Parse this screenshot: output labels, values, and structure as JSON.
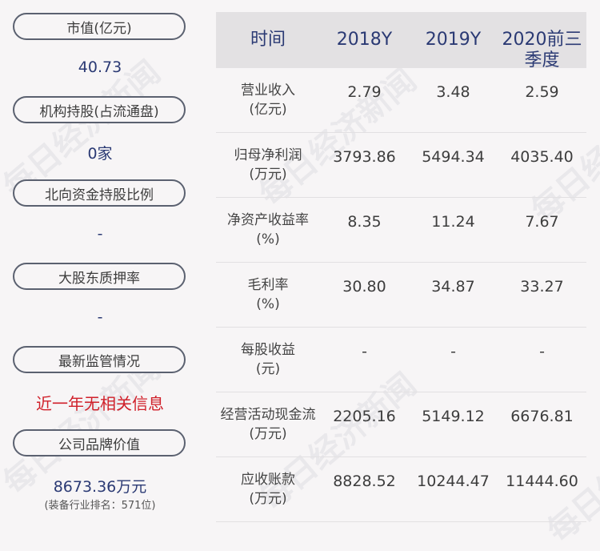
{
  "left_panel": {
    "items": [
      {
        "label": "市值(亿元)",
        "value": "40.73"
      },
      {
        "label": "机构持股(占流通盘)",
        "value": "0家"
      },
      {
        "label": "北向资金持股比例",
        "value": "-"
      },
      {
        "label": "大股东质押率",
        "value": "-"
      },
      {
        "label": "最新监管情况",
        "value": "近一年无相关信息"
      },
      {
        "label": "公司品牌价值",
        "value": "8673.36万元",
        "note": "(装备行业排名：571位)"
      }
    ]
  },
  "table": {
    "headers": [
      "时间",
      "2018Y",
      "2019Y",
      "2020前三季度"
    ],
    "rows": [
      {
        "label1": "营业收入",
        "label2": "(亿元)",
        "values": [
          "2.79",
          "3.48",
          "2.59"
        ]
      },
      {
        "label1": "归母净利润",
        "label2": "(万元)",
        "values": [
          "3793.86",
          "5494.34",
          "4035.40"
        ]
      },
      {
        "label1": "净资产收益率",
        "label2": "(%)",
        "values": [
          "8.35",
          "11.24",
          "7.67"
        ]
      },
      {
        "label1": "毛利率",
        "label2": "(%)",
        "values": [
          "30.80",
          "34.87",
          "33.27"
        ]
      },
      {
        "label1": "每股收益",
        "label2": "(元)",
        "values": [
          "-",
          "-",
          "-"
        ]
      },
      {
        "label1": "经营活动现金流",
        "label2": "(万元)",
        "values": [
          "2205.16",
          "5149.12",
          "6676.81"
        ]
      },
      {
        "label1": "应收账款",
        "label2": "(万元)",
        "values": [
          "8828.52",
          "10244.47",
          "11444.60"
        ]
      }
    ]
  },
  "watermark": "每日经济新闻"
}
